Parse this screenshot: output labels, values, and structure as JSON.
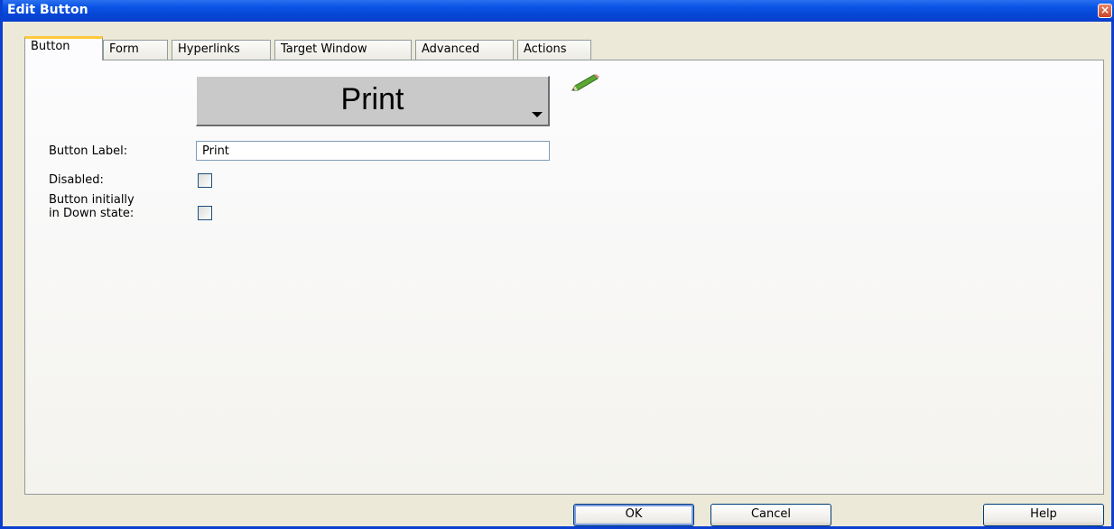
{
  "window": {
    "title": "Edit Button",
    "close_glyph": "×"
  },
  "tabs": [
    {
      "label": "Button",
      "active": true
    },
    {
      "label": "Form"
    },
    {
      "label": "Hyperlinks"
    },
    {
      "label": "Target Window"
    },
    {
      "label": "Advanced"
    },
    {
      "label": "Actions"
    }
  ],
  "preview": {
    "label": "Print",
    "icon": "dropdown-arrow-icon"
  },
  "edit_icon": "pencil-icon",
  "fields": {
    "button_label": {
      "label": "Button Label:",
      "value": "Print"
    },
    "disabled": {
      "label": "Disabled:",
      "checked": false
    },
    "down_state": {
      "label_line1": "Button initially",
      "label_line2": "in Down state:",
      "checked": false
    }
  },
  "buttons": {
    "ok": "OK",
    "cancel": "Cancel",
    "help": "Help"
  },
  "colors": {
    "titlebar": "#0a3fd0",
    "active_tab_accent": "#ffc83c",
    "dialog_bg": "#ece9d8"
  }
}
